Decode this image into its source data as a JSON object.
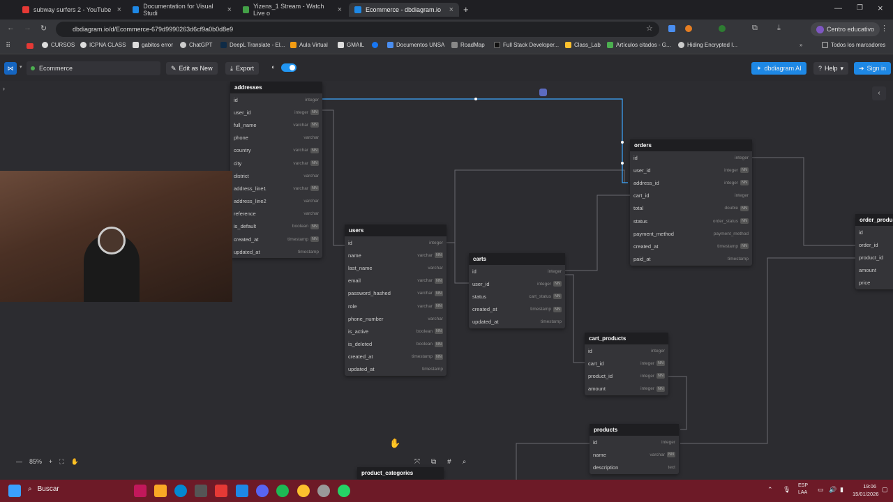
{
  "browser": {
    "tabs": [
      {
        "title": "subway surfers 2 - YouTube",
        "color": "#e53935"
      },
      {
        "title": "Documentation for Visual Studi",
        "color": "#1e88e5"
      },
      {
        "title": "Yizens_1 Stream - Watch Live o",
        "color": "#43a047"
      },
      {
        "title": "Ecommerce - dbdiagram.io",
        "color": "#1e88e5"
      }
    ],
    "url": "dbdiagram.io/d/Ecommerce-679d9990263d6cf9a0b0d8e9",
    "profile": "Centro educativo",
    "bookmarks": [
      "CURSOS",
      "ICPNA CLASS",
      "gabitos error",
      "ChatGPT",
      "DeepL Translate - El...",
      "Aula Virtual",
      "GMAIL",
      "Documentos UNSA",
      "RoadMap",
      "Full Stack Developer...",
      "Class_Lab",
      "Artículos citados - G...",
      "Hiding Encrypted I...",
      "Todos los marcadores"
    ]
  },
  "app": {
    "diagram_name": "Ecommerce",
    "edit_label": "Edit as New",
    "export_label": "Export",
    "ai_label": "dbdiagram AI",
    "help_label": "Help",
    "signin_label": "Sign in",
    "zoom": "85%"
  },
  "tables": {
    "addresses": {
      "name": "addresses",
      "rows": [
        [
          "id",
          "integer",
          ""
        ],
        [
          "user_id",
          "integer",
          "NN"
        ],
        [
          "full_name",
          "varchar",
          "NN"
        ],
        [
          "phone",
          "varchar",
          ""
        ],
        [
          "country",
          "varchar",
          "NN"
        ],
        [
          "city",
          "varchar",
          "NN"
        ],
        [
          "district",
          "varchar",
          ""
        ],
        [
          "address_line1",
          "varchar",
          "NN"
        ],
        [
          "address_line2",
          "varchar",
          ""
        ],
        [
          "reference",
          "varchar",
          ""
        ],
        [
          "is_default",
          "boolean",
          "NN"
        ],
        [
          "created_at",
          "timestamp",
          "NN"
        ],
        [
          "updated_at",
          "timestamp",
          ""
        ]
      ]
    },
    "users": {
      "name": "users",
      "rows": [
        [
          "id",
          "integer",
          ""
        ],
        [
          "name",
          "varchar",
          "NN"
        ],
        [
          "last_name",
          "varchar",
          ""
        ],
        [
          "email",
          "varchar",
          "NN"
        ],
        [
          "password_hashed",
          "varchar",
          "NN"
        ],
        [
          "role",
          "varchar",
          "NN"
        ],
        [
          "phone_number",
          "varchar",
          ""
        ],
        [
          "is_active",
          "boolean",
          "NN"
        ],
        [
          "is_deleted",
          "boolean",
          "NN"
        ],
        [
          "created_at",
          "timestamp",
          "NN"
        ],
        [
          "updated_at",
          "timestamp",
          ""
        ]
      ]
    },
    "carts": {
      "name": "carts",
      "rows": [
        [
          "id",
          "integer",
          ""
        ],
        [
          "user_id",
          "integer",
          "NN"
        ],
        [
          "status",
          "cart_status",
          "NN"
        ],
        [
          "created_at",
          "timestamp",
          "NN"
        ],
        [
          "updated_at",
          "timestamp",
          ""
        ]
      ]
    },
    "orders": {
      "name": "orders",
      "rows": [
        [
          "id",
          "integer",
          ""
        ],
        [
          "user_id",
          "integer",
          "NN"
        ],
        [
          "address_id",
          "integer",
          "NN"
        ],
        [
          "cart_id",
          "integer",
          ""
        ],
        [
          "total",
          "double",
          "NN"
        ],
        [
          "status",
          "order_status",
          "NN"
        ],
        [
          "payment_method",
          "payment_method",
          ""
        ],
        [
          "created_at",
          "timestamp",
          "NN"
        ],
        [
          "paid_at",
          "timestamp",
          ""
        ]
      ]
    },
    "cart_products": {
      "name": "cart_products",
      "rows": [
        [
          "id",
          "integer",
          ""
        ],
        [
          "cart_id",
          "integer",
          "NN"
        ],
        [
          "product_id",
          "integer",
          "NN"
        ],
        [
          "amount",
          "integer",
          "NN"
        ]
      ]
    },
    "products": {
      "name": "products",
      "rows": [
        [
          "id",
          "integer",
          ""
        ],
        [
          "name",
          "varchar",
          "NN"
        ],
        [
          "description",
          "text",
          ""
        ]
      ]
    },
    "order_products": {
      "name": "order_produc",
      "rows": [
        [
          "id",
          "",
          ""
        ],
        [
          "order_id",
          "",
          ""
        ],
        [
          "product_id",
          "",
          ""
        ],
        [
          "amount",
          "",
          ""
        ],
        [
          "price",
          "",
          ""
        ]
      ]
    },
    "product_categories": {
      "name": "product_categories",
      "rows": []
    }
  },
  "taskbar": {
    "search": "Buscar",
    "lang": "ESP LAA",
    "time": "19:06",
    "date": "15/01/2026"
  }
}
